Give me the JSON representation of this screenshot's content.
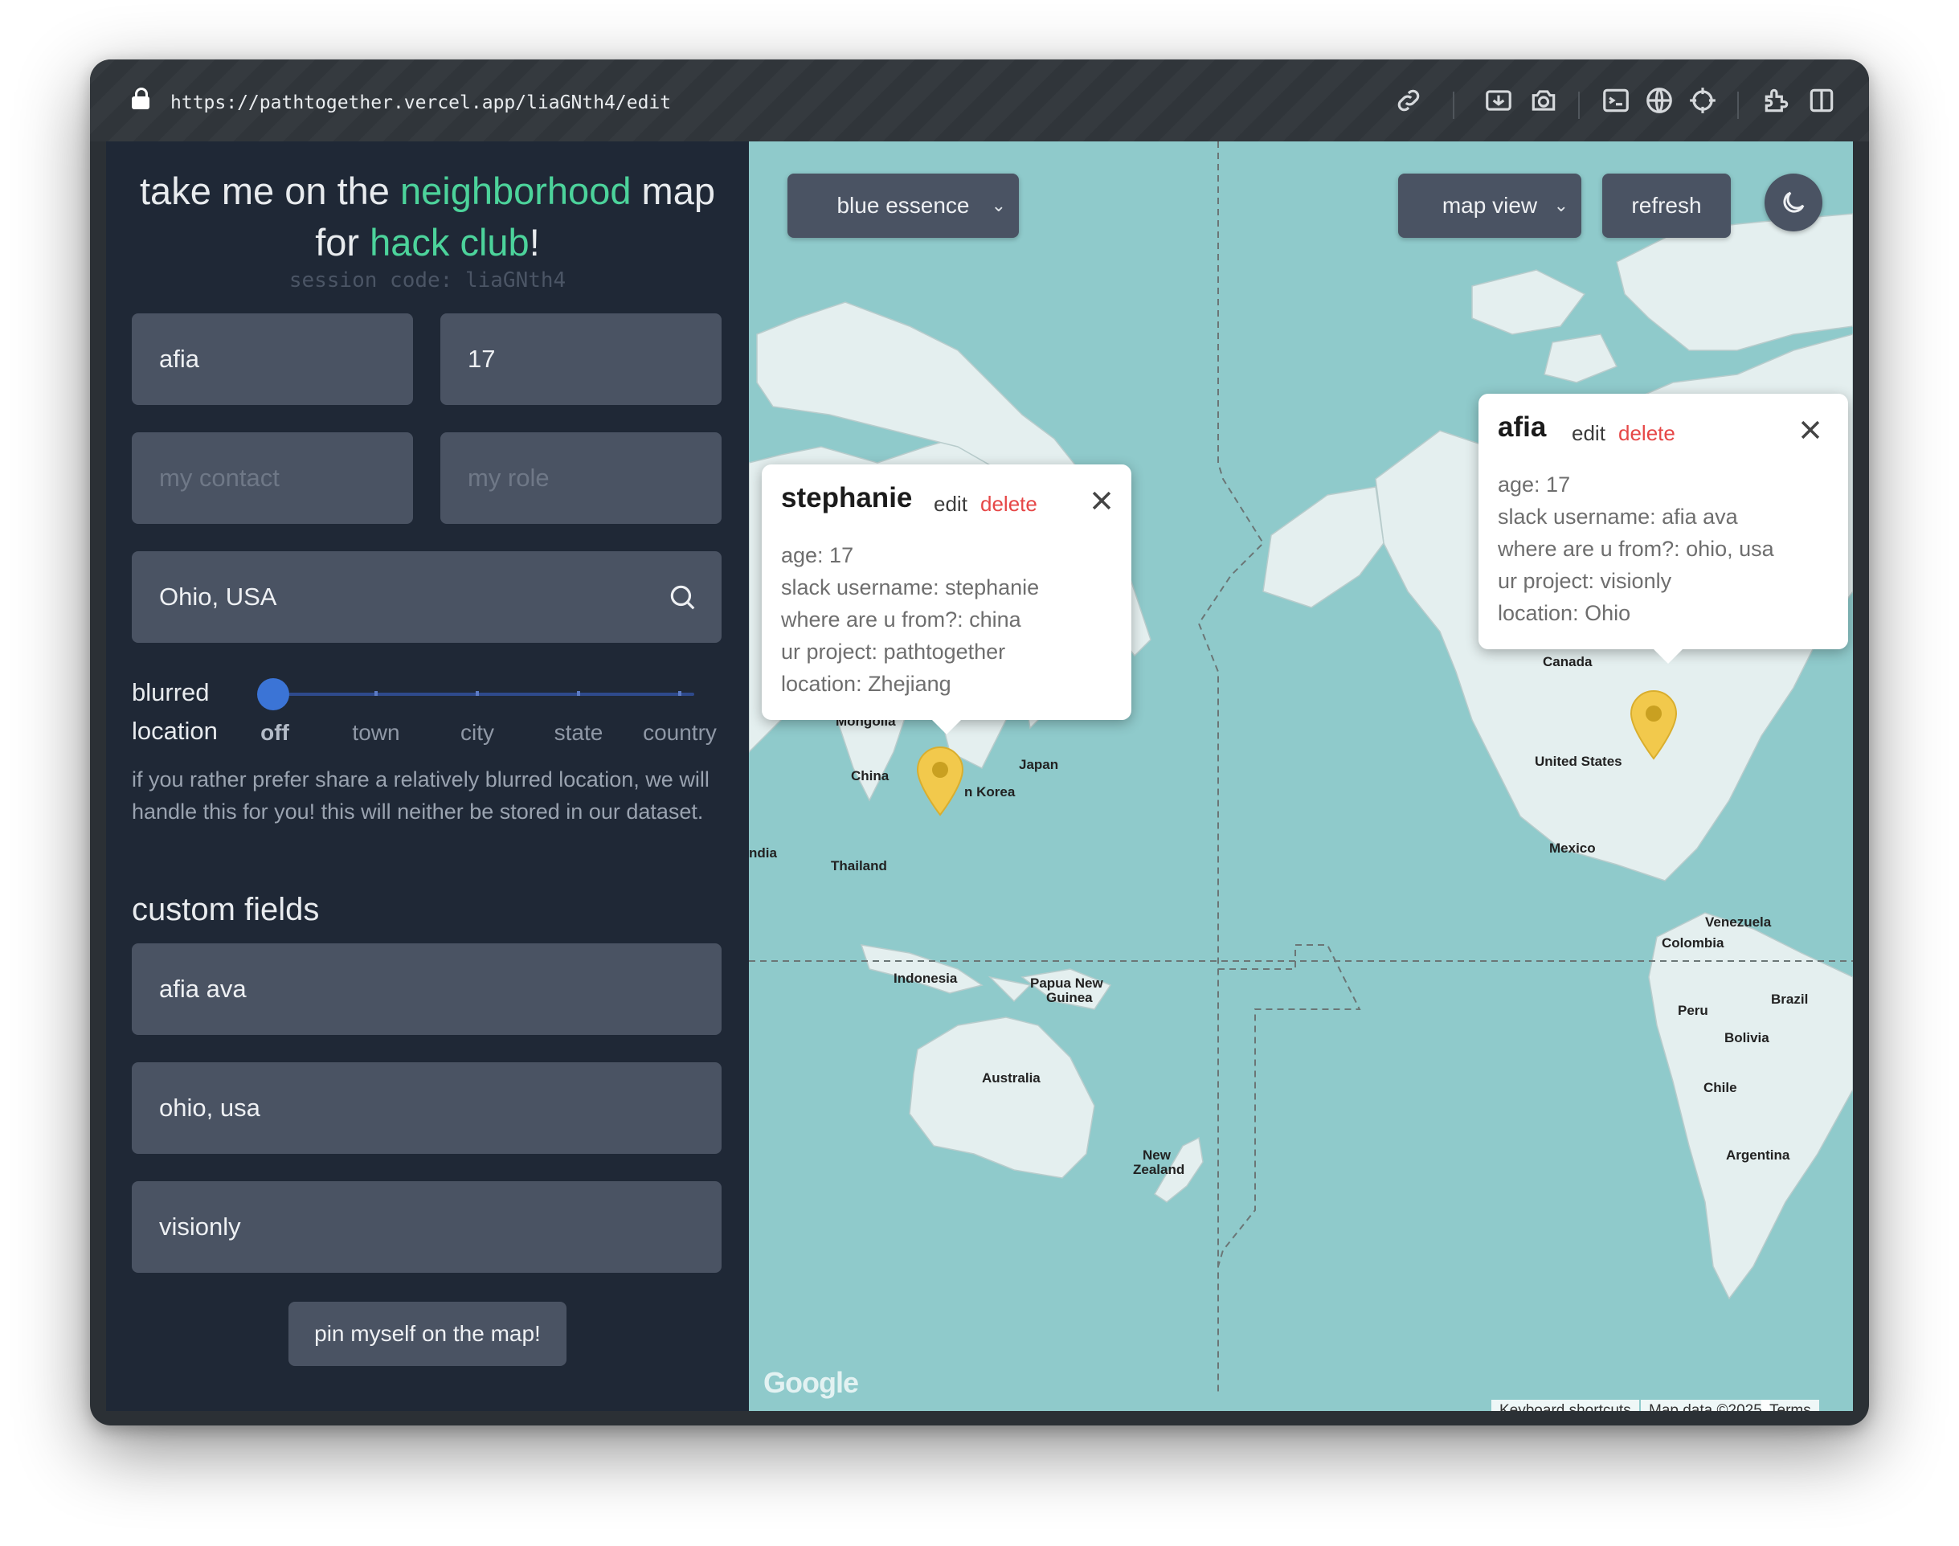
{
  "browser": {
    "url": "https://pathtogether.vercel.app/liaGNth4/edit",
    "toolbar_icons": [
      "link-icon",
      "screenshot-icon",
      "camera-icon",
      "terminal-icon",
      "globe-icon",
      "crosshair-icon",
      "extensions-icon",
      "sidebar-icon"
    ]
  },
  "sidebar": {
    "title_pre": "take me on the ",
    "title_highlight1": "neighborhood",
    "title_mid": " map",
    "title_line2_pre": "for ",
    "title_highlight2": "hack club",
    "title_end": "!",
    "session_code": "session code: liaGNth4",
    "name_value": "afia",
    "age_value": "17",
    "contact_placeholder": "my contact",
    "role_placeholder": "my role",
    "location_value": "Ohio, USA",
    "blur_label_1": "blurred",
    "blur_label_2": "location",
    "blur_stops": [
      "off",
      "town",
      "city",
      "state",
      "country"
    ],
    "blur_selected": "off",
    "note": "if you rather prefer share a relatively blurred location, we will handle this for you! this will neither be stored in our dataset.",
    "custom_fields_heading": "custom fields",
    "custom_fields": [
      "afia ava",
      "ohio, usa",
      "visionly"
    ],
    "pin_button": "pin myself on the map!"
  },
  "map": {
    "theme_select": "blue essence",
    "view_select": "map view",
    "refresh_button": "refresh",
    "labels": {
      "mongolia": "Mongolia",
      "china": "China",
      "korea": "n Korea",
      "japan": "Japan",
      "india": "ndia",
      "thailand": "Thailand",
      "indonesia": "Indonesia",
      "png1": "Papua New",
      "png2": "Guinea",
      "australia": "Australia",
      "nz1": "New",
      "nz2": "Zealand",
      "canada": "Canada",
      "us": "United States",
      "mexico": "Mexico",
      "venezuela": "Venezuela",
      "colombia": "Colombia",
      "peru": "Peru",
      "brazil": "Brazil",
      "bolivia": "Bolivia",
      "chile": "Chile",
      "argentina": "Argentina"
    },
    "attribution": {
      "logo": "Google",
      "shortcuts": "Keyboard shortcuts",
      "data": "Map data ©2025",
      "terms": "Terms"
    },
    "popups": [
      {
        "name": "stephanie",
        "edit": "edit",
        "delete": "delete",
        "lines": [
          "age: 17",
          "slack username: stephanie",
          "where are u from?: china",
          "ur project: pathtogether",
          "location: Zhejiang"
        ]
      },
      {
        "name": "afia",
        "edit": "edit",
        "delete": "delete",
        "lines": [
          "age: 17",
          "slack username: afia ava",
          "where are u from?: ohio, usa",
          "ur project: visionly",
          "location: Ohio"
        ]
      }
    ],
    "pin_color": "#f2c94c"
  }
}
